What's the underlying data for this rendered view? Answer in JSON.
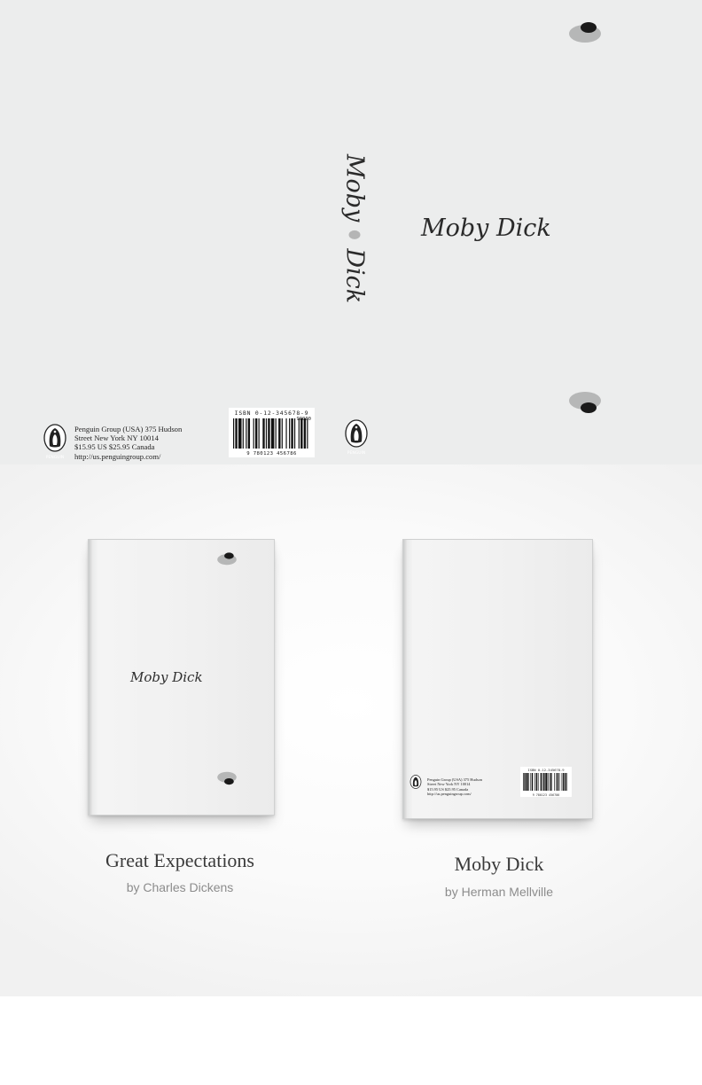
{
  "spread": {
    "spine_title_part1": "Moby",
    "spine_title_part2": "Dick",
    "front_title": "Moby Dick",
    "publisher_lines": [
      "Penguin Group (USA) 375 Hudson",
      "Street New York NY 10014",
      "$15.95 US $25.95 Canada",
      "http://us.penguingroup.com/"
    ],
    "penguin_logo_label": "PENGUIN",
    "barcode": {
      "isbn_text": "ISBN 0-12-345678-9",
      "addon": "90000",
      "digits": "9 780123 456786"
    }
  },
  "books": [
    {
      "cover_title": "Moby Dick",
      "caption_title": "Great Expectations",
      "caption_author": "by Charles Dickens"
    },
    {
      "caption_title": "Moby Dick",
      "caption_author": "by Herman Mellville",
      "publisher_lines": [
        "Penguin Group (USA) 375 Hudson",
        "Street New York NY 10014",
        "$15.95 US $25.95 Canada",
        "http://us.penguingroup.com/"
      ],
      "barcode": {
        "isbn_text": "ISBN 0-12-345678-9",
        "digits": "9 780123 456786"
      }
    }
  ],
  "colors": {
    "cover_background": "#eceded",
    "eye_light": "#b6b7b7",
    "eye_dark": "#1a1a1a",
    "title_text": "#2a2a2a",
    "caption_title": "#3a3a3a",
    "caption_author": "#8c8c8c"
  },
  "icons": {
    "whale_eye": "whale-eye-icon",
    "penguin": "penguin-logo-icon",
    "barcode": "barcode-icon"
  }
}
